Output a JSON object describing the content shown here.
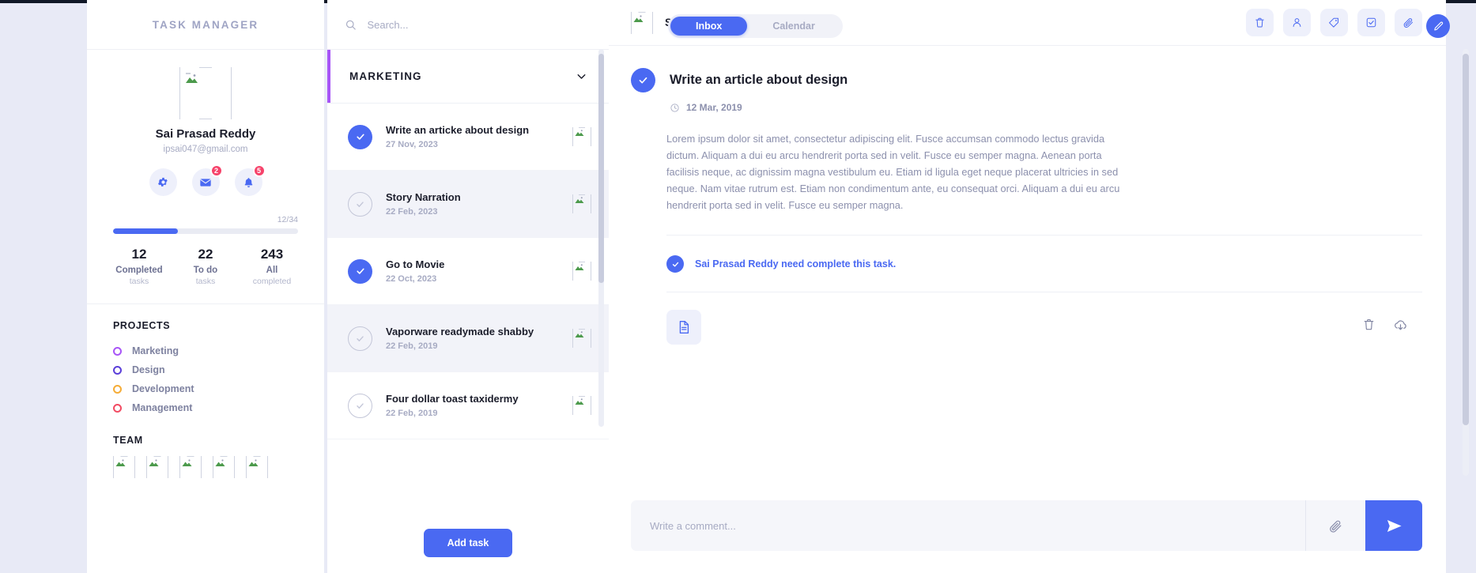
{
  "sidebar": {
    "brand": "TASK MANAGER",
    "profile": {
      "name": "Sai Prasad Reddy",
      "email": "ipsai047@gmail.com"
    },
    "quick_actions": [
      {
        "name": "settings",
        "icon": "gear-icon",
        "badge": null
      },
      {
        "name": "messages",
        "icon": "mail-icon",
        "badge": "2"
      },
      {
        "name": "notifications",
        "icon": "bell-icon",
        "badge": "5"
      }
    ],
    "progress": {
      "count_label": "12/34",
      "percent": 35
    },
    "stats": [
      {
        "value": "12",
        "label": "Completed",
        "sub": "tasks"
      },
      {
        "value": "22",
        "label": "To do",
        "sub": "tasks"
      },
      {
        "value": "243",
        "label": "All",
        "sub": "completed"
      }
    ],
    "projects_title": "PROJECTS",
    "projects": [
      {
        "label": "Marketing",
        "color": "#a855f7"
      },
      {
        "label": "Design",
        "color": "#5b3fd9"
      },
      {
        "label": "Development",
        "color": "#f5ac37"
      },
      {
        "label": "Management",
        "color": "#f24b63"
      }
    ],
    "team_title": "TEAM",
    "team_count": 5
  },
  "search": {
    "placeholder": "Search...",
    "value": ""
  },
  "view_toggle": {
    "options": [
      "Inbox",
      "Calendar"
    ],
    "selected": "Inbox"
  },
  "tasklist": {
    "group_title": "MARKETING",
    "group_color": "#a855f7",
    "add_button": "Add task",
    "tasks": [
      {
        "title": "Write an articke about design",
        "date": "27 Nov, 2023",
        "done": true,
        "highlight": false
      },
      {
        "title": "Story Narration",
        "date": "22 Feb, 2023",
        "done": false,
        "highlight": true
      },
      {
        "title": "Go to Movie",
        "date": "22 Oct, 2023",
        "done": true,
        "highlight": false
      },
      {
        "title": "Vaporware readymade shabby",
        "date": "22 Feb, 2019",
        "done": false,
        "highlight": true
      },
      {
        "title": "Four dollar toast taxidermy",
        "date": "22 Feb, 2019",
        "done": false,
        "highlight": false
      }
    ]
  },
  "detail": {
    "user": "Sai Prasad Reddy",
    "actions": [
      {
        "name": "delete-task",
        "icon": "trash-icon"
      },
      {
        "name": "assign-user",
        "icon": "user-icon"
      },
      {
        "name": "add-tag",
        "icon": "tag-icon"
      },
      {
        "name": "mark-done",
        "icon": "check-square-icon"
      },
      {
        "name": "attach-file",
        "icon": "paperclip-icon"
      }
    ],
    "title": "Write an article about design",
    "date": "12 Mar, 2019",
    "done": true,
    "body": "Lorem ipsum dolor sit amet, consectetur adipiscing elit. Fusce accumsan commodo lectus gravida dictum. Aliquam a dui eu arcu hendrerit porta sed in velit. Fusce eu semper magna. Aenean porta facilisis neque, ac dignissim magna vestibulum eu. Etiam id ligula eget neque placerat ultricies in sed neque. Nam vitae rutrum est. Etiam non condimentum ante, eu consequat orci. Aliquam a dui eu arcu hendrerit porta sed in velit. Fusce eu semper magna.",
    "assignment_note": "Sai Prasad Reddy need complete this task.",
    "attachment": {
      "icon": "file-icon"
    },
    "attachment_actions": [
      {
        "name": "delete-attachment",
        "icon": "trash-icon"
      },
      {
        "name": "download-attachment",
        "icon": "download-cloud-icon"
      }
    ],
    "comment_placeholder": "Write a comment...",
    "comment_value": ""
  },
  "fab": {
    "name": "compose",
    "icon": "pencil-icon"
  },
  "colors": {
    "accent": "#4a69f2",
    "badge": "#f6436b",
    "page_bg": "#e8eaf6",
    "muted_text": "#a7abc3"
  }
}
